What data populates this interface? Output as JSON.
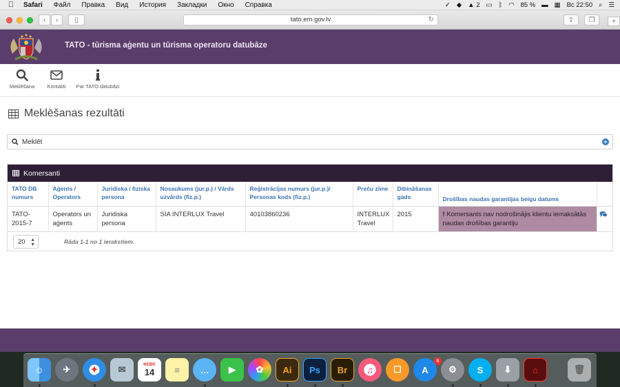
{
  "menubar": {
    "items": [
      "Safari",
      "Файл",
      "Правка",
      "Вид",
      "История",
      "Закладки",
      "Окно",
      "Справка"
    ],
    "status_text_a": "2",
    "battery": "85 %",
    "clock": "Вс 22:50"
  },
  "browser": {
    "url": "tato.em.gov.lv"
  },
  "site": {
    "title": "TATO - tūrisma aģentu un tūrisma operatoru datubāze",
    "colors": {
      "header": "#5a3d6a",
      "panel_head": "#2e1f37",
      "warning_cell": "#ae8ba3",
      "link": "#3a74b3"
    }
  },
  "nav": {
    "items": [
      {
        "label": "Meklēšana",
        "icon": "search-icon"
      },
      {
        "label": "Kontakti",
        "icon": "envelope-icon"
      },
      {
        "label": "Par TATO datubāzi",
        "icon": "info-icon"
      }
    ]
  },
  "page": {
    "title": "Meklēšanas rezultāti"
  },
  "search": {
    "label": "Meklēt"
  },
  "results": {
    "panel_title": "Komersanti",
    "columns": [
      "TATO DB numurs",
      "Aģents / Operators",
      "Juridiska / fiziska persona",
      "Nosaukums (jur.p.) / Vārds uzvārds (fiz.p.)",
      "Reģistrācijas numurs (jur.p.)/ Personas kods (fiz.p.)",
      "Preču zīme",
      "Dibināšanas gads",
      "Drošības naudas garantijas beigu datums"
    ],
    "rows": [
      {
        "tato_nr": "TATO-2015-7",
        "agent_operator": "Operators un aģents",
        "person_type": "Juridiska persona",
        "name": "SIA INTERLUX Travel",
        "reg_nr": "40103860236",
        "trademark": "INTERLUX Travel",
        "founded": "2015",
        "guarantee": "Komersants nav nodrošinājis klientu iemaksātās naudas drošības garantiju",
        "guarantee_icon": "exclamation-icon"
      }
    ],
    "page_size": "20",
    "records_text": "Rāda 1-1 no 1 ierakstiem."
  },
  "dock": {
    "calendar_month": "ФЕВР.",
    "calendar_day": "14",
    "appstore_badge": "6",
    "illustrator": "Ai",
    "photoshop": "Ps",
    "bridge": "Br"
  }
}
